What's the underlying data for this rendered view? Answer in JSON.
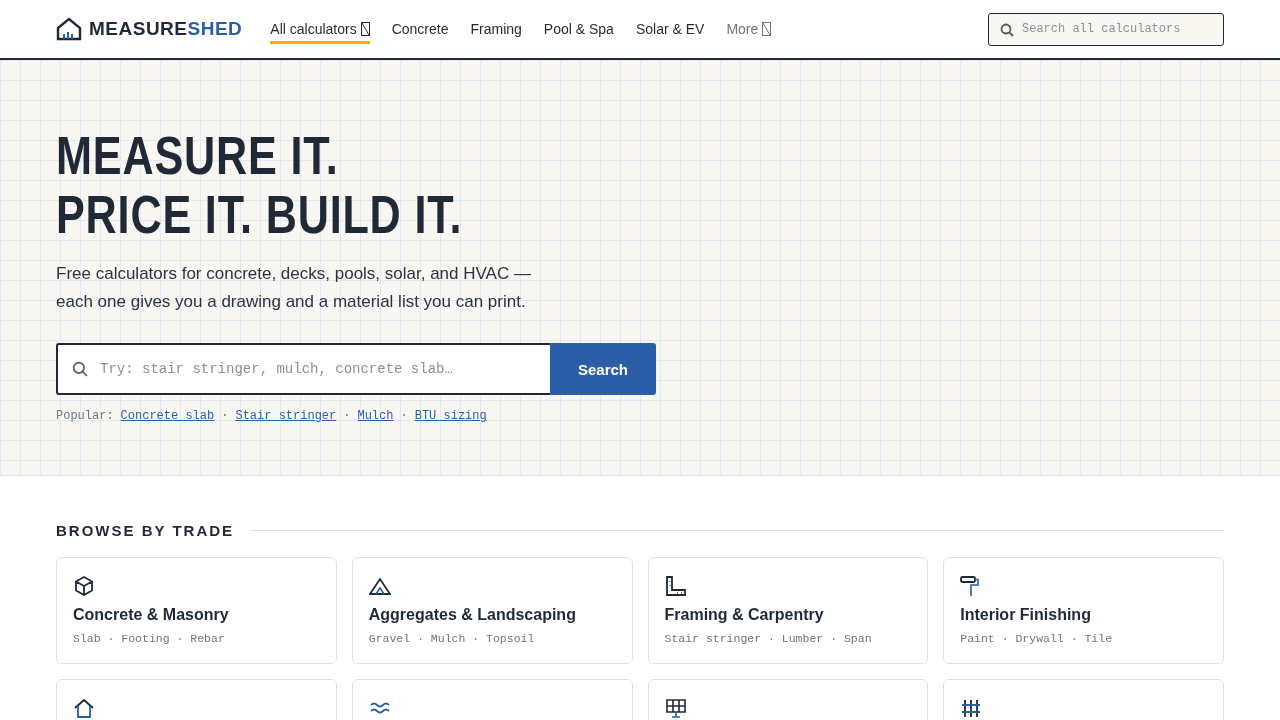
{
  "header": {
    "logo": {
      "part_1": "MEASURE",
      "part_2": "SHED"
    },
    "nav": [
      {
        "label": "All calculators",
        "selected": true,
        "dropdown": true,
        "muted": false
      },
      {
        "label": "Concrete",
        "selected": false,
        "dropdown": false,
        "muted": false
      },
      {
        "label": "Framing",
        "selected": false,
        "dropdown": false,
        "muted": false
      },
      {
        "label": "Pool & Spa",
        "selected": false,
        "dropdown": false,
        "muted": false
      },
      {
        "label": "Solar & EV",
        "selected": false,
        "dropdown": false,
        "muted": false
      },
      {
        "label": "More",
        "selected": false,
        "dropdown": true,
        "muted": true
      }
    ],
    "search": {
      "placeholder": "Search all calculators"
    }
  },
  "hero": {
    "title_lines": [
      "MEASURE IT.",
      "PRICE IT. BUILD IT."
    ],
    "subtitle": "Free calculators for concrete, decks, pools, solar, and HVAC — each one gives you a drawing and a material list you can print.",
    "search": {
      "placeholder": "Try: stair stringer, mulch, concrete slab…",
      "button": "Search"
    },
    "popular": {
      "label": "Popular:",
      "separator": "·",
      "links": [
        "Concrete slab",
        "Stair stringer",
        "Mulch",
        "BTU sizing"
      ]
    }
  },
  "browse": {
    "title": "BROWSE BY TRADE",
    "cards": [
      {
        "kind": "full",
        "title": "Concrete & Masonry",
        "tags": "Slab · Footing · Rebar"
      },
      {
        "kind": "full",
        "title": "Aggregates & Landscaping",
        "tags": "Gravel · Mulch · Topsoil"
      },
      {
        "kind": "full",
        "title": "Framing & Carpentry",
        "tags": "Stair stringer · Lumber · Span"
      },
      {
        "kind": "full",
        "title": "Interior Finishing",
        "tags": "Paint · Drywall · Tile"
      },
      {
        "kind": "cut_off"
      },
      {
        "kind": "cut_off"
      },
      {
        "kind": "cut_off"
      },
      {
        "kind": "cut_off"
      }
    ]
  }
}
